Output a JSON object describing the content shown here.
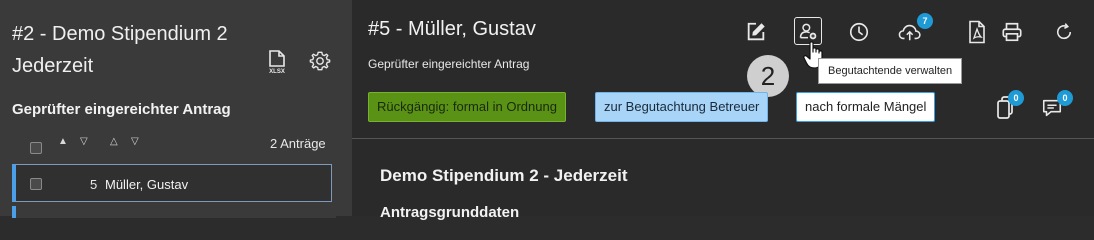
{
  "sidebar": {
    "title": "#2 - Demo Stipendium 2 Jederzeit",
    "section_title": "Geprüfter eingereichter Antrag",
    "count_label": "2 Anträge",
    "items": [
      {
        "number": "5",
        "name": "Müller, Gustav"
      }
    ]
  },
  "main": {
    "title": "#5 - Müller, Gustav",
    "subtitle": "Geprüfter eingereichter Antrag",
    "toolbar": {
      "upload_badge": "7",
      "tooltip": "Begutachtende verwalten"
    },
    "step_marker": "2",
    "status_buttons": [
      "Rückgängig: formal in Ordnung",
      "zur Begutachtung Betreuer",
      "nach formale Mängel"
    ],
    "copy_badge": "0",
    "comments_badge": "0",
    "document": {
      "title": "Demo Stipendium 2 - Jederzeit",
      "section": "Antragsgrunddaten"
    }
  },
  "icons": {
    "xlsx_label": "XLSX"
  }
}
